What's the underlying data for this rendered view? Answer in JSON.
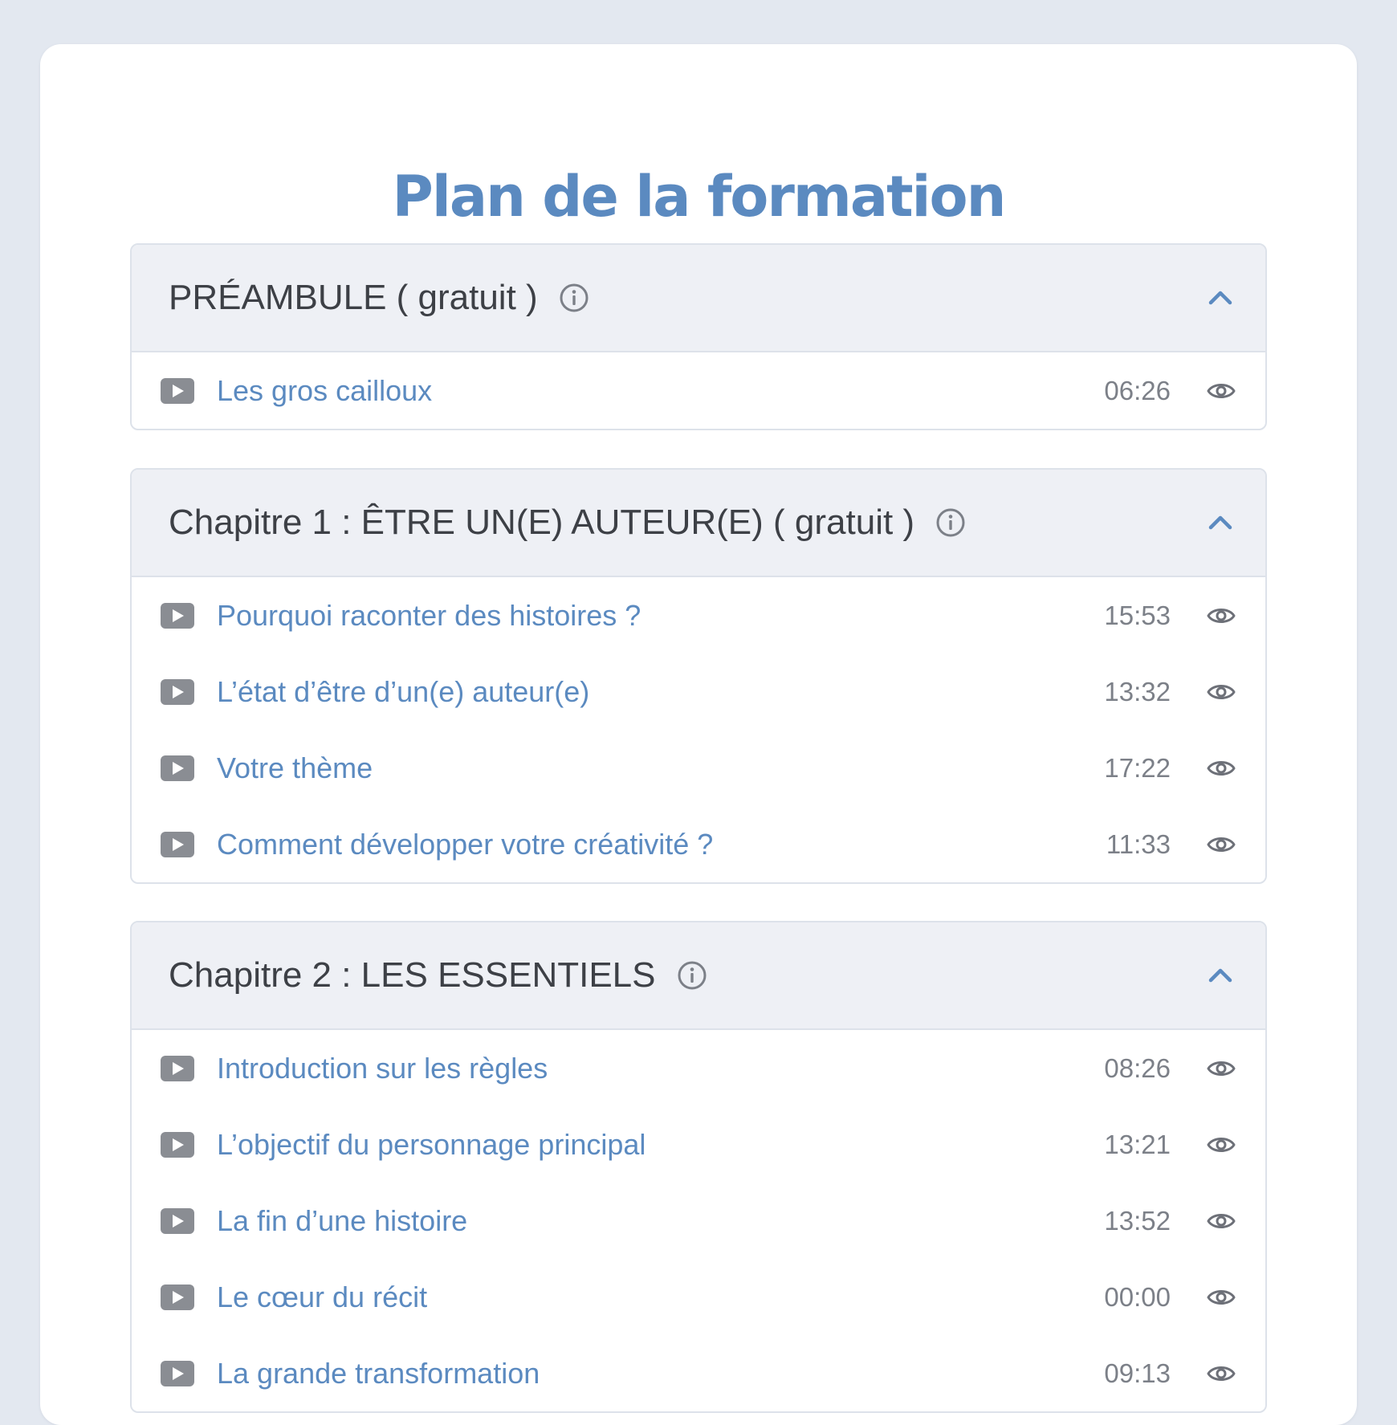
{
  "page_title": "Plan de la formation",
  "colors": {
    "background": "#e3e8f0",
    "title": "#5b8ac0",
    "lesson_link": "#5b8ac0",
    "header_bg": "#eef0f5",
    "header_text": "#3d4046",
    "duration_text": "#7c8088",
    "icon_gray": "#8a8d93"
  },
  "sections": [
    {
      "title": "PRÉAMBULE ( gratuit )",
      "info_icon": "info-circle-icon",
      "toggle_icon": "chevron-up-icon",
      "lessons": [
        {
          "title": "Les gros cailloux",
          "duration": "06:26"
        }
      ]
    },
    {
      "title": "Chapitre 1 : ÊTRE UN(E) AUTEUR(E) ( gratuit )",
      "info_icon": "info-circle-icon",
      "toggle_icon": "chevron-up-icon",
      "lessons": [
        {
          "title": "Pourquoi raconter des histoires ?",
          "duration": "15:53"
        },
        {
          "title": "L’état d’être d’un(e) auteur(e)",
          "duration": "13:32"
        },
        {
          "title": "Votre thème",
          "duration": "17:22"
        },
        {
          "title": "Comment développer votre créativité ?",
          "duration": "11:33"
        }
      ]
    },
    {
      "title": "Chapitre 2 : LES ESSENTIELS",
      "info_icon": "info-circle-icon",
      "toggle_icon": "chevron-up-icon",
      "lessons": [
        {
          "title": "Introduction sur les règles",
          "duration": "08:26"
        },
        {
          "title": "L’objectif du personnage principal",
          "duration": "13:21"
        },
        {
          "title": "La fin d’une histoire",
          "duration": "13:52"
        },
        {
          "title": "Le cœur du récit",
          "duration": "00:00"
        },
        {
          "title": "La grande transformation",
          "duration": "09:13"
        }
      ]
    }
  ]
}
